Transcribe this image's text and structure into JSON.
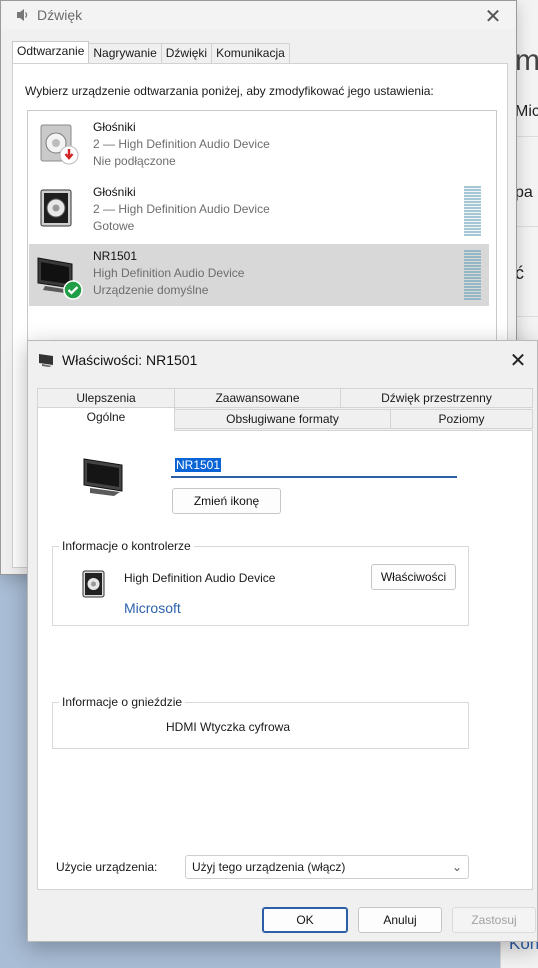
{
  "background_app": {
    "fragments": [
      "m",
      "Micr",
      "pa",
      "ć",
      "Kon"
    ]
  },
  "sound_dialog": {
    "title": "Dźwięk",
    "tabs": [
      "Odtwarzanie",
      "Nagrywanie",
      "Dźwięki",
      "Komunikacja"
    ],
    "active_tab": "Odtwarzanie",
    "instruction": "Wybierz urządzenie odtwarzania poniżej, aby zmodyfikować jego ustawienia:",
    "devices": [
      {
        "name": "Głośniki",
        "desc": "2 — High Definition Audio Device",
        "status": "Nie podłączone",
        "icon": "speaker-unplugged-icon"
      },
      {
        "name": "Głośniki",
        "desc": "2 — High Definition Audio Device",
        "status": "Gotowe",
        "icon": "speaker-icon"
      },
      {
        "name": "NR1501",
        "desc": "High Definition Audio Device",
        "status": "Urządzenie domyślne",
        "icon": "monitor-default-icon",
        "selected": true
      }
    ]
  },
  "properties_dialog": {
    "title": "Właściwości: NR1501",
    "tabs_row_top": [
      "Ulepszenia",
      "Zaawansowane",
      "Dźwięk przestrzenny"
    ],
    "tabs_row_bottom": [
      "Ogólne",
      "Obsługiwane formaty",
      "Poziomy"
    ],
    "active_tab": "Ogólne",
    "device_name_value": "NR1501",
    "change_icon_button": "Zmień ikonę",
    "controller_group": {
      "title": "Informacje o kontrolerze",
      "device": "High Definition Audio Device",
      "manufacturer": "Microsoft",
      "properties_button": "Właściwości"
    },
    "jack_group": {
      "title": "Informacje o gnieździe",
      "value": "HDMI Wtyczka cyfrowa"
    },
    "usage": {
      "label": "Użycie urządzenia:",
      "selected": "Użyj tego urządzenia (włącz)"
    },
    "buttons": {
      "ok": "OK",
      "cancel": "Anuluj",
      "apply": "Zastosuj"
    }
  }
}
